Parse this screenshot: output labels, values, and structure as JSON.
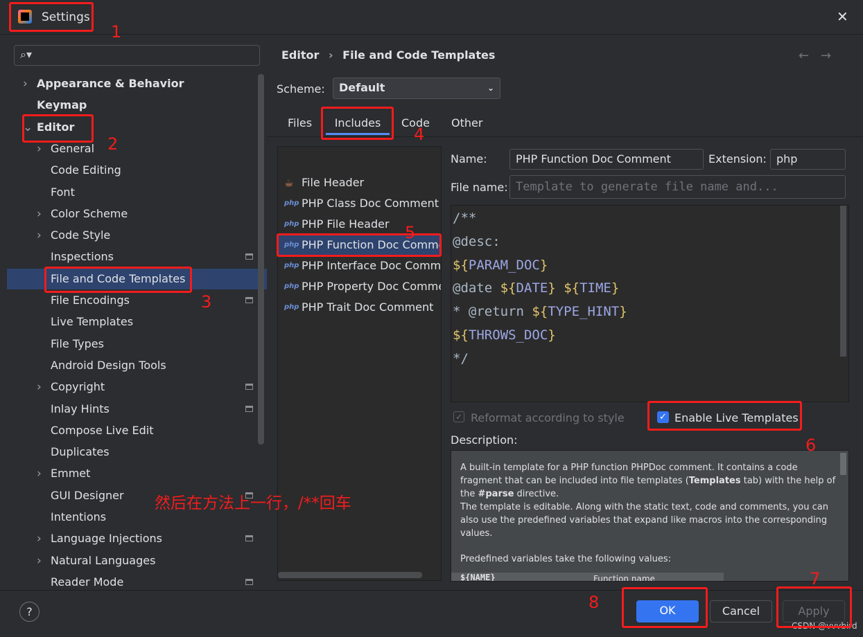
{
  "window": {
    "title": "Settings",
    "close_icon": "close-icon",
    "logo": "intellij-logo"
  },
  "breadcrumb": {
    "parent": "Editor",
    "separator": "›",
    "current": "File and Code Templates"
  },
  "nav": {
    "back": "←",
    "forward": "→"
  },
  "scheme": {
    "label": "Scheme:",
    "value": "Default"
  },
  "tabs": [
    {
      "label": "Files"
    },
    {
      "label": "Includes",
      "selected": true
    },
    {
      "label": "Code"
    },
    {
      "label": "Other"
    }
  ],
  "sidebar": {
    "items": [
      {
        "label": "Appearance & Behavior",
        "level": 0,
        "expandable": true
      },
      {
        "label": "Keymap",
        "level": 0
      },
      {
        "label": "Editor",
        "level": 0,
        "expanded": true
      },
      {
        "label": "General",
        "level": 1,
        "expandable": true
      },
      {
        "label": "Code Editing",
        "level": 1
      },
      {
        "label": "Font",
        "level": 1
      },
      {
        "label": "Color Scheme",
        "level": 1,
        "expandable": true
      },
      {
        "label": "Code Style",
        "level": 1,
        "expandable": true
      },
      {
        "label": "Inspections",
        "level": 1,
        "modified": true
      },
      {
        "label": "File and Code Templates",
        "level": 1,
        "selected": true
      },
      {
        "label": "File Encodings",
        "level": 1,
        "modified": true
      },
      {
        "label": "Live Templates",
        "level": 1
      },
      {
        "label": "File Types",
        "level": 1
      },
      {
        "label": "Android Design Tools",
        "level": 1
      },
      {
        "label": "Copyright",
        "level": 1,
        "expandable": true,
        "modified": true
      },
      {
        "label": "Inlay Hints",
        "level": 1,
        "modified": true
      },
      {
        "label": "Compose Live Edit",
        "level": 1
      },
      {
        "label": "Duplicates",
        "level": 1
      },
      {
        "label": "Emmet",
        "level": 1,
        "expandable": true
      },
      {
        "label": "GUI Designer",
        "level": 1,
        "modified": true
      },
      {
        "label": "Intentions",
        "level": 1
      },
      {
        "label": "Language Injections",
        "level": 1,
        "expandable": true,
        "modified": true
      },
      {
        "label": "Natural Languages",
        "level": 1,
        "expandable": true
      },
      {
        "label": "Reader Mode",
        "level": 1,
        "modified": true
      }
    ]
  },
  "templates": [
    {
      "label": "File Header",
      "icon": "coffee-icon"
    },
    {
      "label": "PHP Class Doc Comment",
      "icon": "php"
    },
    {
      "label": "PHP File Header",
      "icon": "php"
    },
    {
      "label": "PHP Function Doc Comment",
      "icon": "php",
      "selected": true
    },
    {
      "label": "PHP Interface Doc Comment",
      "icon": "php"
    },
    {
      "label": "PHP Property Doc Comment",
      "icon": "php"
    },
    {
      "label": "PHP Trait Doc Comment",
      "icon": "php"
    }
  ],
  "form": {
    "name_label": "Name:",
    "name_value": "PHP Function Doc Comment",
    "ext_label": "Extension:",
    "ext_value": "php",
    "filename_label": "File name:",
    "filename_placeholder": "Template to generate file name and..."
  },
  "code": {
    "l1": "/**",
    "l2": "@desc:",
    "v_param": "PARAM_DOC",
    "l4a": "@date ",
    "v_date": "DATE",
    "v_time": "TIME",
    "l5a": "* @return ",
    "v_type": "TYPE_HINT",
    "v_throws": "THROWS_DOC",
    "l7": "*/",
    "dollar_open": "${",
    "close": "}"
  },
  "options": {
    "reformat": "Reformat according to style",
    "reformat_checked": true,
    "reformat_disabled": true,
    "live": "Enable Live Templates",
    "live_checked": true
  },
  "description": {
    "label": "Description:",
    "p1a": "A built-in template for a PHP function PHPDoc comment. It contains a code fragment that can be included into file templates (",
    "p1b": "Templates",
    "p1c": " tab) with the help of the ",
    "p1d": "#parse",
    "p1e": " directive.",
    "p2": "The template is editable. Along with the static text, code and comments, you can also use the predefined variables that expand like macros into the corresponding values.",
    "p3": "Predefined variables take the following values:",
    "row_var": "${NAME}",
    "row_val": "Function name"
  },
  "buttons": {
    "help": "?",
    "ok": "OK",
    "cancel": "Cancel",
    "apply": "Apply"
  },
  "annotations": {
    "n1": "1",
    "n2": "2",
    "n3": "3",
    "n4": "4",
    "n5": "5",
    "n6": "6",
    "n7": "7",
    "n8": "8",
    "note": "然后在方法上一行，/**回车",
    "color": "#f41c1c"
  },
  "watermark": "CSDN @vvvbird"
}
